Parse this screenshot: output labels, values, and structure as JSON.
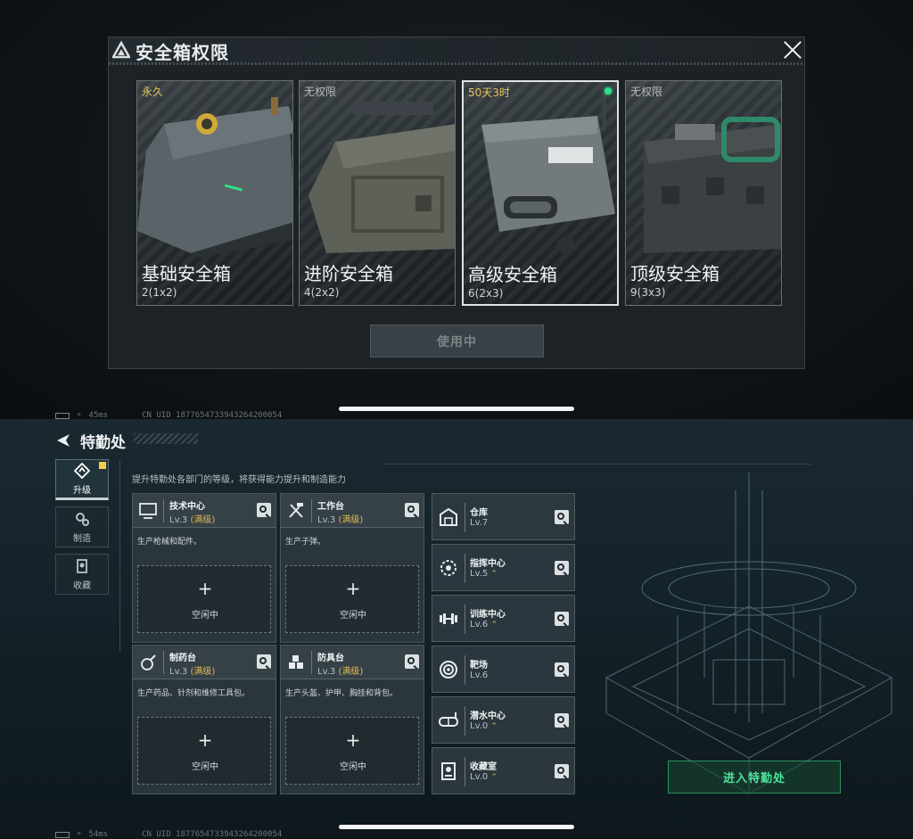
{
  "modal": {
    "title": "安全箱权限",
    "cards": [
      {
        "tag": "永久",
        "name": "基础安全箱",
        "size": "2(1x2)"
      },
      {
        "tag": "无权限",
        "name": "进阶安全箱",
        "size": "4(2x2)"
      },
      {
        "tag": "50天3时",
        "name": "高级安全箱",
        "size": "6(2x3)"
      },
      {
        "tag": "无权限",
        "name": "顶级安全箱",
        "size": "9(3x3)"
      }
    ],
    "in_use_label": "使用中"
  },
  "status_top": {
    "ping": "45ms",
    "uid": "CN UID 1877654733943264200054"
  },
  "status_bottom": {
    "ping": "54ms",
    "uid": "CN UID 1877654733943264200054"
  },
  "page": {
    "title": "特勤处",
    "hint": "提升特勤处各部门的等级，将获得能力提升和制造能力",
    "tabs": [
      {
        "label": "升级",
        "icon": "upgrade-icon"
      },
      {
        "label": "制造",
        "icon": "gears-icon"
      },
      {
        "label": "收藏",
        "icon": "collection-icon"
      }
    ],
    "departments": [
      {
        "name": "技术中心",
        "level": "Lv.3",
        "max": "(满级)",
        "desc": "生产枪械和配件。",
        "slot": "空闲中"
      },
      {
        "name": "工作台",
        "level": "Lv.3",
        "max": "(满级)",
        "desc": "生产子弹。",
        "slot": "空闲中"
      },
      {
        "name": "制药台",
        "level": "Lv.3",
        "max": "(满级)",
        "desc": "生产药品、针剂和维修工具包。",
        "slot": "空闲中"
      },
      {
        "name": "防具台",
        "level": "Lv.3",
        "max": "(满级)",
        "desc": "生产头盔、护甲、胸挂和背包。",
        "slot": "空闲中"
      }
    ],
    "facilities": [
      {
        "name": "仓库",
        "level": "Lv.7",
        "up": ""
      },
      {
        "name": "指挥中心",
        "level": "Lv.5",
        "up": "⌃"
      },
      {
        "name": "训练中心",
        "level": "Lv.6",
        "up": "⌃"
      },
      {
        "name": "靶场",
        "level": "Lv.6",
        "up": ""
      },
      {
        "name": "潜水中心",
        "level": "Lv.0",
        "up": "⌃"
      },
      {
        "name": "收藏室",
        "level": "Lv.0",
        "up": "⌃"
      }
    ],
    "enter_label": "进入特勤处",
    "slot_plus": "+"
  },
  "colors": {
    "gold": "#e6c45a",
    "green": "#2fe08a",
    "accent_green": "#4ce49a"
  }
}
